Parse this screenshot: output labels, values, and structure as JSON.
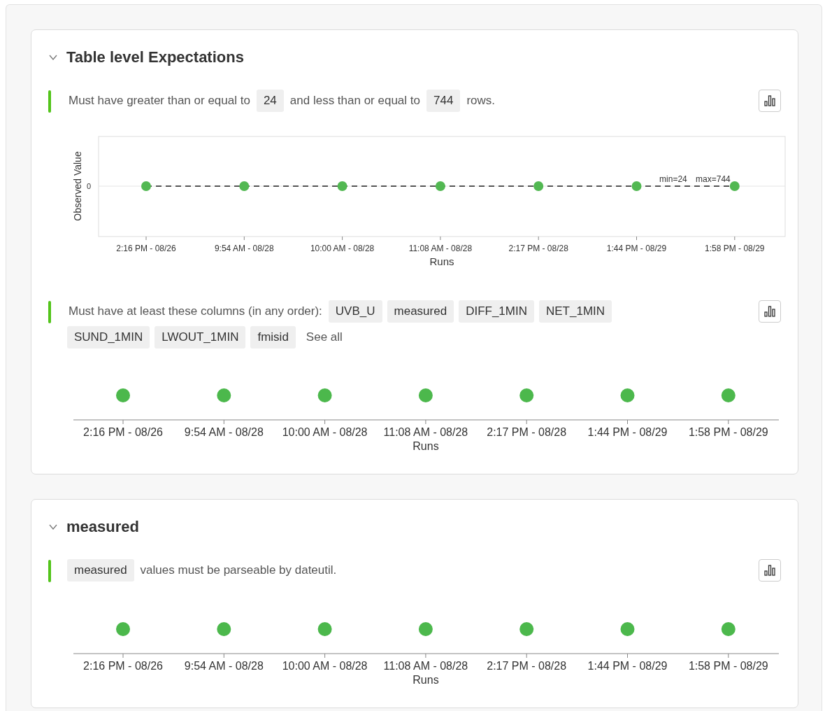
{
  "sections": [
    {
      "title": "Table level Expectations",
      "expanded": true,
      "expectations": [
        {
          "parts": [
            {
              "kind": "text",
              "text": "Must have greater than or equal to"
            },
            {
              "kind": "code",
              "text": "24"
            },
            {
              "kind": "text",
              "text": "and less than or equal to"
            },
            {
              "kind": "code",
              "text": "744"
            },
            {
              "kind": "text",
              "text": "rows."
            }
          ],
          "plot": {
            "kind": "observed",
            "y_axis_title": "Observed Value",
            "y_tick": "0",
            "thresholds": [
              "min=24",
              "max=744"
            ],
            "runs": [
              "2:16 PM - 08/26",
              "9:54 AM - 08/28",
              "10:00 AM - 08/28",
              "11:08 AM - 08/28",
              "2:17 PM - 08/28",
              "1:44 PM - 08/29",
              "1:58 PM - 08/29"
            ],
            "x_axis_title": "Runs"
          }
        },
        {
          "parts": [
            {
              "kind": "text",
              "text": "Must have at least these columns (in any order):"
            },
            {
              "kind": "code",
              "text": "UVB_U"
            },
            {
              "kind": "code",
              "text": "measured"
            },
            {
              "kind": "code",
              "text": "DIFF_1MIN"
            },
            {
              "kind": "code",
              "text": "NET_1MIN"
            },
            {
              "kind": "code",
              "text": "SUND_1MIN"
            },
            {
              "kind": "code",
              "text": "LWOUT_1MIN"
            },
            {
              "kind": "code",
              "text": "fmisid"
            },
            {
              "kind": "link",
              "text": "See all"
            }
          ],
          "plot": {
            "kind": "runs",
            "runs": [
              "2:16 PM - 08/26",
              "9:54 AM - 08/28",
              "10:00 AM - 08/28",
              "11:08 AM - 08/28",
              "2:17 PM - 08/28",
              "1:44 PM - 08/29",
              "1:58 PM - 08/29"
            ],
            "x_axis_title": "Runs"
          }
        }
      ]
    },
    {
      "title": "measured",
      "expanded": true,
      "expectations": [
        {
          "parts": [
            {
              "kind": "code",
              "text": "measured"
            },
            {
              "kind": "text",
              "text": "values must be parseable by dateutil."
            }
          ],
          "plot": {
            "kind": "runs",
            "runs": [
              "2:16 PM - 08/26",
              "9:54 AM - 08/28",
              "10:00 AM - 08/28",
              "11:08 AM - 08/28",
              "2:17 PM - 08/28",
              "1:44 PM - 08/29",
              "1:58 PM - 08/29"
            ],
            "x_axis_title": "Runs"
          }
        }
      ]
    }
  ]
}
